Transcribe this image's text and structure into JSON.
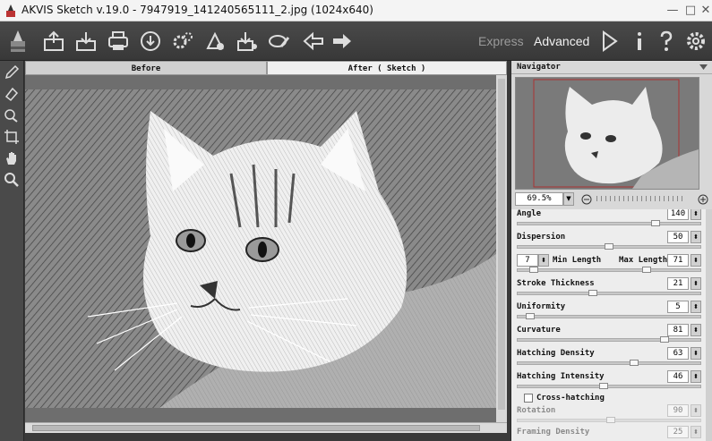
{
  "window": {
    "title": "AKVIS Sketch v.19.0 - 7947919_141240565111_2.jpg (1024x640)",
    "minimize": "—",
    "maximize": "□",
    "close": "✕"
  },
  "toolbar": {
    "icons": [
      "brush-logo-icon",
      "open-icon",
      "save-icon",
      "print-icon",
      "share-icon",
      "batch-settings-icon",
      "preferences-icon",
      "import-icon",
      "export-icon",
      "eraser-icon",
      "back-icon",
      "forward-icon"
    ],
    "mode_express": "Express",
    "mode_advanced": "Advanced",
    "run_icon": "play-icon",
    "info_icon": "info-icon",
    "help_icon": "help-icon",
    "settings_icon": "gear-icon"
  },
  "tabs": {
    "before": "Before",
    "after": "After ( Sketch )"
  },
  "navigator": {
    "title": "Navigator",
    "zoom": "69.5%"
  },
  "params": {
    "angle": {
      "label": "Angle",
      "value": "140"
    },
    "dispersion": {
      "label": "Dispersion",
      "value": "50"
    },
    "min_length": {
      "label": "Min Length",
      "value": "7"
    },
    "max_length": {
      "label": "Max Length",
      "value": "71"
    },
    "stroke_thickness": {
      "label": "Stroke Thickness",
      "value": "21"
    },
    "uniformity": {
      "label": "Uniformity",
      "value": "5"
    },
    "curvature": {
      "label": "Curvature",
      "value": "81"
    },
    "hatching_density": {
      "label": "Hatching Density",
      "value": "63"
    },
    "hatching_intensity": {
      "label": "Hatching Intensity",
      "value": "46"
    },
    "cross_hatching": {
      "label": "Cross-hatching"
    },
    "rotation": {
      "label": "Rotation",
      "value": "90"
    },
    "framing_density": {
      "label": "Framing Density",
      "value": "25"
    }
  },
  "colors": {
    "accent": "#e8e8e8",
    "toolbar": "#3f3f3f"
  }
}
